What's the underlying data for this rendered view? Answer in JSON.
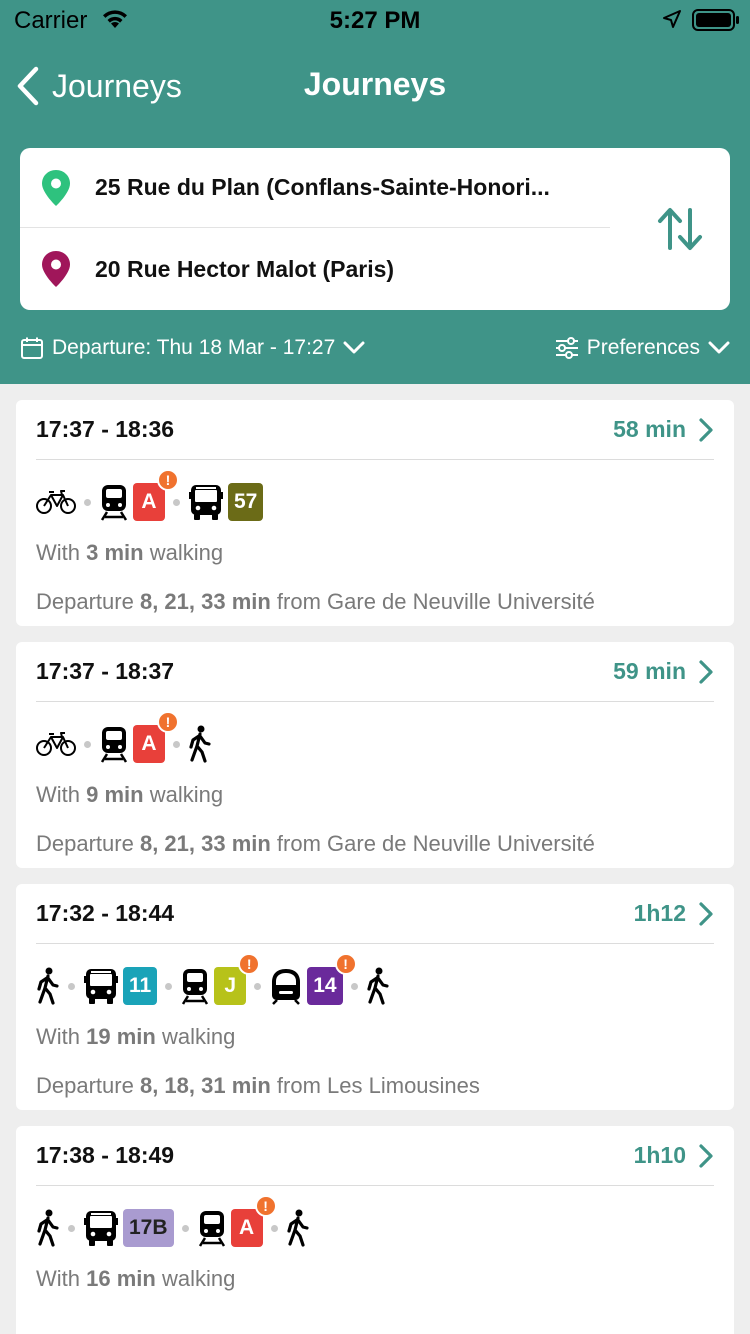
{
  "status_bar": {
    "carrier": "Carrier",
    "time": "5:27 PM"
  },
  "nav": {
    "back_label": "Journeys",
    "title": "Journeys"
  },
  "addresses": {
    "from": "25 Rue du Plan (Conflans-Sainte-Honori...",
    "to": "20 Rue Hector Malot (Paris)"
  },
  "options": {
    "departure": "Departure: Thu 18 Mar - 17:27",
    "preferences": "Preferences"
  },
  "colors": {
    "header": "#3f9488",
    "accent": "#3f9488",
    "alert": "#f0722e"
  },
  "journeys": [
    {
      "times": "17:37 - 18:36",
      "duration": "58 min",
      "walk_prefix": "With ",
      "walk_value": "3 min",
      "walk_suffix": " walking",
      "dep_prefix": "Departure ",
      "dep_value": "8, 21, 33 min",
      "dep_suffix": " from Gare de Neuville Université",
      "legs": [
        {
          "icon": "bike-icon"
        },
        {
          "icon": "train-icon",
          "line": "A",
          "color": "#e8403a",
          "alert": "!"
        },
        {
          "icon": "bus-icon",
          "line": "57",
          "color": "#6b6b17"
        }
      ]
    },
    {
      "times": "17:37 - 18:37",
      "duration": "59 min",
      "walk_prefix": "With ",
      "walk_value": "9 min",
      "walk_suffix": " walking",
      "dep_prefix": "Departure ",
      "dep_value": "8, 21, 33 min",
      "dep_suffix": " from Gare de Neuville Université",
      "legs": [
        {
          "icon": "bike-icon"
        },
        {
          "icon": "train-icon",
          "line": "A",
          "color": "#e8403a",
          "alert": "!"
        },
        {
          "icon": "walk-icon"
        }
      ]
    },
    {
      "times": "17:32 - 18:44",
      "duration": "1h12",
      "walk_prefix": "With ",
      "walk_value": "19 min",
      "walk_suffix": " walking",
      "dep_prefix": "Departure ",
      "dep_value": "8, 18, 31 min",
      "dep_suffix": " from Les Limousines",
      "legs": [
        {
          "icon": "walk-icon"
        },
        {
          "icon": "bus-icon",
          "line": "11",
          "color": "#1aa3b8"
        },
        {
          "icon": "train-icon",
          "line": "J",
          "color": "#b7c21a",
          "alert": "!"
        },
        {
          "icon": "metro-icon",
          "line": "14",
          "color": "#6a2a9b",
          "alert": "!"
        },
        {
          "icon": "walk-icon"
        }
      ]
    },
    {
      "times": "17:38 - 18:49",
      "duration": "1h10",
      "walk_prefix": "With ",
      "walk_value": "16 min",
      "walk_suffix": " walking",
      "dep_prefix": "",
      "dep_value": "",
      "dep_suffix": "",
      "legs": [
        {
          "icon": "walk-icon"
        },
        {
          "icon": "bus-icon",
          "line": "17B",
          "color": "#a99bd0",
          "text_color": "#222222"
        },
        {
          "icon": "train-icon",
          "line": "A",
          "color": "#e8403a",
          "alert": "!"
        },
        {
          "icon": "walk-icon"
        }
      ]
    }
  ]
}
